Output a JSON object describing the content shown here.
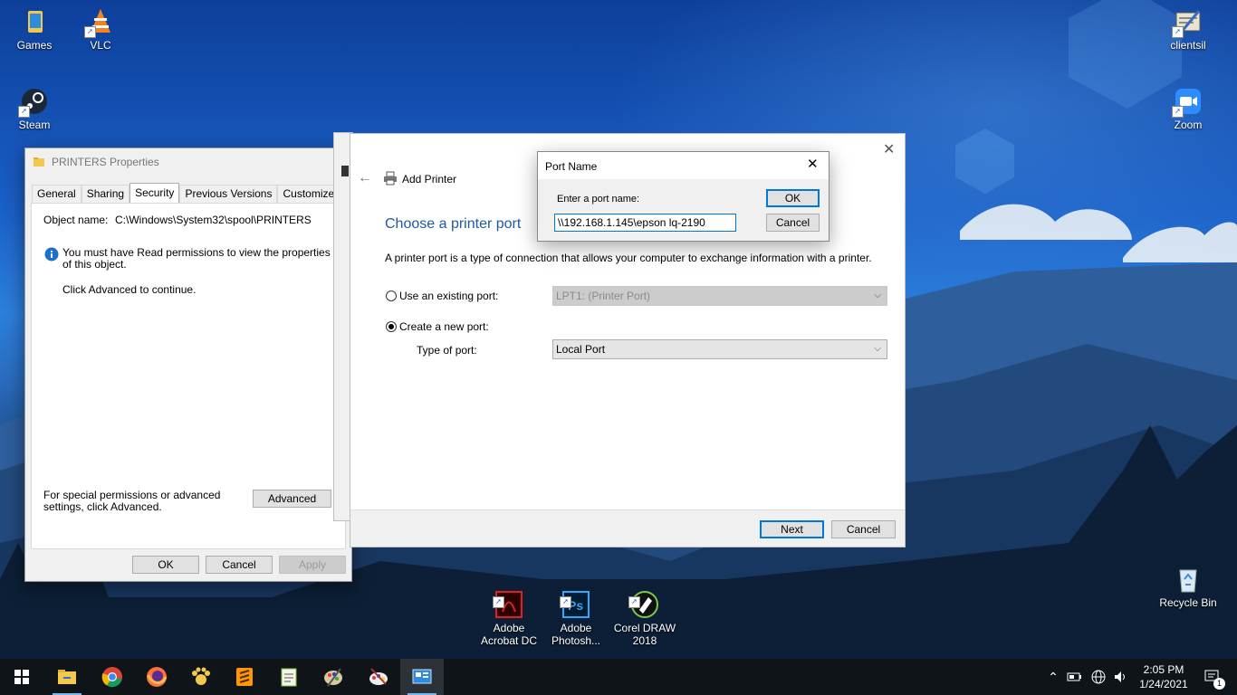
{
  "desktop": {
    "icons": [
      {
        "label": "Games"
      },
      {
        "label": "VLC"
      },
      {
        "label": "Steam"
      },
      {
        "label": "clientsil"
      },
      {
        "label": "Zoom"
      },
      {
        "label": "Adobe\nAcrobat DC"
      },
      {
        "label": "Adobe\nPhotosh..."
      },
      {
        "label": "Corel DRAW\n2018"
      },
      {
        "label": "Recycle Bin"
      }
    ]
  },
  "properties": {
    "title": "PRINTERS Properties",
    "tabs": [
      "General",
      "Sharing",
      "Security",
      "Previous Versions",
      "Customize"
    ],
    "active_tab": "Security",
    "object_name_label": "Object name:",
    "object_name_value": "C:\\Windows\\System32\\spool\\PRINTERS",
    "info_text": "You must have Read permissions to view the properties of this object.",
    "click_advanced": "Click Advanced to continue.",
    "special_text": "For special permissions or advanced settings, click Advanced.",
    "advanced_button": "Advanced",
    "ok_button": "OK",
    "cancel_button": "Cancel",
    "apply_button": "Apply"
  },
  "wizard": {
    "title": "Add Printer",
    "heading": "Choose a printer port",
    "description": "A printer port is a type of connection that allows your computer to exchange information with a printer.",
    "existing_port_label": "Use an existing port:",
    "existing_port_value": "LPT1: (Printer Port)",
    "new_port_label": "Create a new port:",
    "type_of_port_label": "Type of port:",
    "type_of_port_value": "Local Port",
    "selected_option": "Create a new port",
    "next_button": "Next",
    "cancel_button": "Cancel"
  },
  "port_dialog": {
    "title": "Port Name",
    "prompt": "Enter a port name:",
    "value": "\\\\192.168.1.145\\epson lq-2190",
    "ok_button": "OK",
    "cancel_button": "Cancel"
  },
  "taskbar": {
    "apps": [
      "start-icon",
      "file-explorer-icon",
      "chrome-icon",
      "firefox-icon",
      "paw-app-icon",
      "sublime-icon",
      "notepad-plus-icon",
      "paint-icon",
      "paint-brush-icon",
      "control-panel-icon"
    ],
    "time": "2:05 PM",
    "date": "1/24/2021",
    "notification_count": "1"
  },
  "colors": {
    "accent": "#0078d7",
    "heading_blue": "#1e5aa6",
    "taskbar": "#0f1418"
  }
}
